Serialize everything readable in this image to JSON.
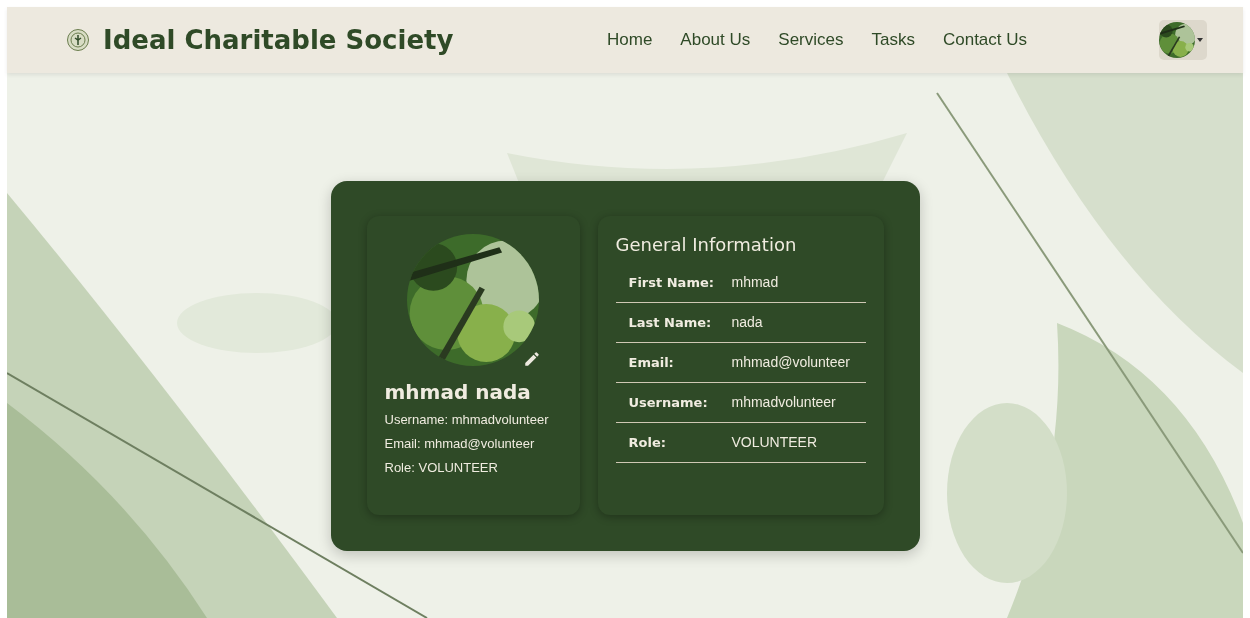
{
  "header": {
    "brand": "Ideal Charitable Society",
    "nav": [
      {
        "label": "Home"
      },
      {
        "label": "About Us"
      },
      {
        "label": "Services"
      },
      {
        "label": "Tasks"
      },
      {
        "label": "Contact Us"
      }
    ]
  },
  "profile": {
    "name": "mhmad nada",
    "details": [
      "Username: mhmadvolunteer",
      "Email: mhmad@volunteer",
      "Role: VOLUNTEER"
    ]
  },
  "general_information": {
    "title": "General Information",
    "rows": [
      {
        "label": "First Name:",
        "value": "mhmad"
      },
      {
        "label": "Last Name:",
        "value": "nada"
      },
      {
        "label": "Email:",
        "value": "mhmad@volunteer"
      },
      {
        "label": "Username:",
        "value": "mhmadvolunteer"
      },
      {
        "label": "Role:",
        "value": "VOLUNTEER"
      }
    ]
  }
}
